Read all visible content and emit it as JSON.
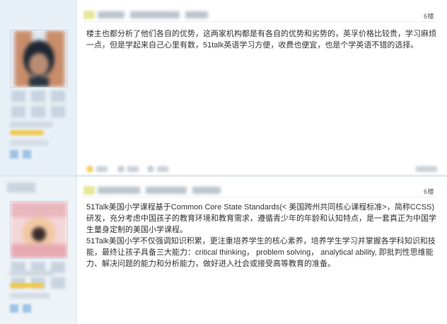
{
  "posts": [
    {
      "floor": "6楼",
      "body": "楼主也都分析了他们各自的优势，这两家机构都是有各自的优势和劣势的，英孚价格比较贵，学习麻烦一点，但是学起来自己心里有数，51talk英语学习方便，收费也便宜，也是个学英语不错的选择。"
    },
    {
      "floor": "6楼",
      "body": "51Talk美国小学课程基于Common Core State Standards(< 美国跨州共同核心课程标准>，简称CCSS) 研发，充分考虑中国孩子的教育环境和教育需求，遵循青少年的年龄和认知特点，是一套真正为中国学生量身定制的美国小学课程。",
      "body2": "51Talk美国小学不仅强调知识积累，更注重培养学生的核心素养，培养学生学习并掌握各学科知识和技能，最终让孩子具备三大能力：critical thinking， problem solving， analytical ability, 即批判性思维能力、解决问题的能力和分析能力，做好进入社会或接受高等教育的准备。"
    }
  ],
  "colors": {
    "sidebar": "#e8f0f7",
    "badge": "#f2c84b",
    "divider": "#e3e9ef"
  }
}
